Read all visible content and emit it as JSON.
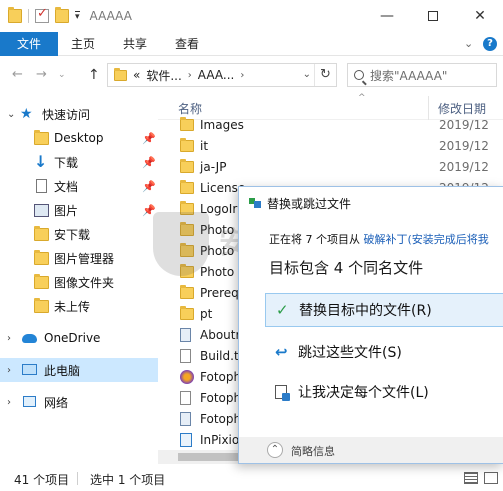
{
  "window": {
    "title": "AAAAA",
    "min_glyph": "—",
    "close_glyph": "✕"
  },
  "ribbon": {
    "tabs": [
      "文件",
      "主页",
      "共享",
      "查看"
    ],
    "expand_glyph": "⌄",
    "help_glyph": "?"
  },
  "address": {
    "back_glyph": "←",
    "forward_glyph": "→",
    "history_glyph": "⌄",
    "up_glyph": "↑",
    "lead": "«",
    "crumbs": [
      "软件...",
      "AAA..."
    ],
    "chevron": "›",
    "dropdown_glyph": "⌄",
    "refresh_glyph": "↻"
  },
  "search": {
    "placeholder": "搜索\"AAAAA\""
  },
  "navpane": {
    "expand_glyph": "›",
    "collapse_glyph": "⌄",
    "pin_glyph": "📌",
    "items": [
      {
        "label": "快速访问",
        "icon": "star-icon"
      },
      {
        "label": "Desktop",
        "icon": "folder-icon"
      },
      {
        "label": "下载",
        "icon": "download-icon"
      },
      {
        "label": "文档",
        "icon": "document-icon"
      },
      {
        "label": "图片",
        "icon": "picture-icon"
      },
      {
        "label": "安下载",
        "icon": "folder-icon"
      },
      {
        "label": "图片管理器",
        "icon": "folder-icon"
      },
      {
        "label": "图像文件夹",
        "icon": "folder-icon"
      },
      {
        "label": "未上传",
        "icon": "folder-icon"
      },
      {
        "label": "OneDrive",
        "icon": "cloud-icon"
      },
      {
        "label": "此电脑",
        "icon": "computer-icon"
      },
      {
        "label": "网络",
        "icon": "network-icon"
      }
    ],
    "star_glyph": "★",
    "download_glyph": "↓"
  },
  "filelist": {
    "columns": {
      "name": "名称",
      "date": "修改日期",
      "sort_glyph": "^"
    },
    "rows": [
      {
        "name": "Images",
        "date": "2019/12",
        "icon": "folder-icon"
      },
      {
        "name": "it",
        "date": "2019/12",
        "icon": "folder-icon"
      },
      {
        "name": "ja-JP",
        "date": "2019/12",
        "icon": "folder-icon"
      },
      {
        "name": "License",
        "date": "2019/12",
        "icon": "folder-icon"
      },
      {
        "name": "LogoIr",
        "date": "",
        "icon": "folder-icon"
      },
      {
        "name": "Photo",
        "date": "",
        "icon": "folder-icon"
      },
      {
        "name": "Photo",
        "date": "",
        "icon": "folder-icon"
      },
      {
        "name": "Photo",
        "date": "",
        "icon": "folder-icon"
      },
      {
        "name": "Prereq",
        "date": "",
        "icon": "folder-icon"
      },
      {
        "name": "pt",
        "date": "",
        "icon": "folder-icon"
      },
      {
        "name": "Aboutr",
        "date": "",
        "icon": "blue-file-icon"
      },
      {
        "name": "Build.tx",
        "date": "",
        "icon": "text-file-icon"
      },
      {
        "name": "Fotoph",
        "date": "",
        "icon": "app-icon"
      },
      {
        "name": "Fotoph",
        "date": "",
        "icon": "file-icon"
      },
      {
        "name": "Fotoph",
        "date": "",
        "icon": "blue-file-icon"
      },
      {
        "name": "InPixio",
        "date": "",
        "icon": "search-doc-icon"
      }
    ]
  },
  "status": {
    "count": "41 个项目",
    "selected": "选中 1 个项目"
  },
  "dialog": {
    "title": "替换或跳过文件",
    "progress_prefix": "正在将 7 个项目从 ",
    "progress_source": "破解补丁(安装完成后将我",
    "heading": "目标包含 4 个同名文件",
    "options": [
      {
        "label": "替换目标中的文件(R)",
        "glyph": "✓"
      },
      {
        "label": "跳过这些文件(S)",
        "glyph": "↩"
      },
      {
        "label": "让我决定每个文件(L)"
      }
    ],
    "less_glyph": "⌃",
    "less_label": "简略信息"
  },
  "watermark": {
    "text": "安下载"
  },
  "colors": {
    "accent": "#1979ca",
    "selection": "#cce8ff",
    "folder": "#f8cf5a",
    "link": "#1b5fb8",
    "check": "#2c9d49"
  }
}
